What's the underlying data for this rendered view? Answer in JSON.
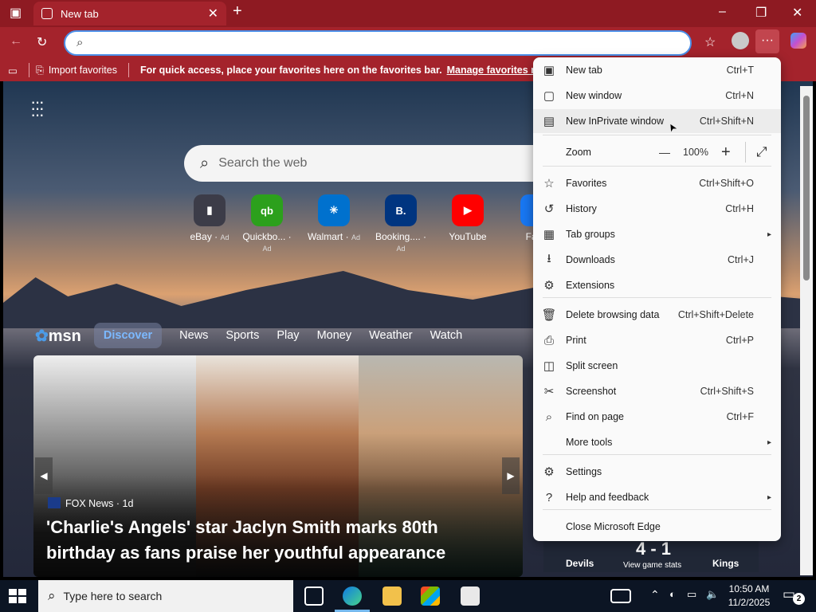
{
  "window": {
    "tab_title": "New tab",
    "tab_close_glyph": "✕",
    "new_tab_glyph": "+"
  },
  "favbar": {
    "import_label": "Import favorites",
    "prompt": "For quick access, place your favorites here on the favorites bar.",
    "manage_link": "Manage favorites now"
  },
  "newtab": {
    "search_placeholder": "Search the web",
    "tiles": [
      {
        "label": "eBay",
        "ad": "Ad",
        "icon": "ebay-icon",
        "color": "#3c3c48"
      },
      {
        "label": "Quickbo...",
        "ad": "Ad",
        "icon": "quickbooks-icon",
        "color": "#2ca01c"
      },
      {
        "label": "Walmart",
        "ad": "Ad",
        "icon": "walmart-icon",
        "color": "#0071ce"
      },
      {
        "label": "Booking....",
        "ad": "Ad",
        "icon": "booking-icon",
        "color": "#003580"
      },
      {
        "label": "YouTube",
        "ad": "",
        "icon": "youtube-icon",
        "color": "#ff0000"
      },
      {
        "label": "Face",
        "ad": "",
        "icon": "facebook-icon",
        "color": "#1877f2"
      }
    ],
    "tile_glyphs": [
      "▮",
      "qb",
      "✳",
      "B.",
      "▶",
      ""
    ]
  },
  "msn": {
    "logo": "msn",
    "tabs": [
      "Discover",
      "News",
      "Sports",
      "Play",
      "Money",
      "Weather",
      "Watch"
    ],
    "active_tab": "Discover",
    "story": {
      "source": "FOX News · 1d",
      "headline": "'Charlie's Angels' star Jaclyn Smith marks 80th birthday as fans praise her youthful appearance"
    },
    "score": {
      "team_left": "Devils",
      "team_right": "Kings",
      "score": "4 - 1",
      "link": "View game stats"
    }
  },
  "menu": {
    "items": [
      {
        "label": "New tab",
        "shortcut": "Ctrl+T",
        "icon": "new-tab-icon"
      },
      {
        "label": "New window",
        "shortcut": "Ctrl+N",
        "icon": "new-window-icon"
      },
      {
        "label": "New InPrivate window",
        "shortcut": "Ctrl+Shift+N",
        "icon": "inprivate-icon"
      },
      {
        "label": "Zoom",
        "value": "100%",
        "icon": ""
      },
      {
        "label": "Favorites",
        "shortcut": "Ctrl+Shift+O",
        "icon": "favorites-icon"
      },
      {
        "label": "History",
        "shortcut": "Ctrl+H",
        "icon": "history-icon"
      },
      {
        "label": "Tab groups",
        "shortcut": "",
        "icon": "tab-groups-icon"
      },
      {
        "label": "Downloads",
        "shortcut": "Ctrl+J",
        "icon": "downloads-icon"
      },
      {
        "label": "Extensions",
        "shortcut": "",
        "icon": "extensions-icon"
      },
      {
        "label": "Delete browsing data",
        "shortcut": "Ctrl+Shift+Delete",
        "icon": "trash-icon"
      },
      {
        "label": "Print",
        "shortcut": "Ctrl+P",
        "icon": "print-icon"
      },
      {
        "label": "Split screen",
        "shortcut": "",
        "icon": "split-screen-icon"
      },
      {
        "label": "Screenshot",
        "shortcut": "Ctrl+Shift+S",
        "icon": "screenshot-icon"
      },
      {
        "label": "Find on page",
        "shortcut": "Ctrl+F",
        "icon": "find-icon"
      },
      {
        "label": "More tools",
        "shortcut": "",
        "icon": ""
      },
      {
        "label": "Settings",
        "shortcut": "",
        "icon": "gear-icon"
      },
      {
        "label": "Help and feedback",
        "shortcut": "",
        "icon": "help-icon"
      },
      {
        "label": "Close Microsoft Edge",
        "shortcut": "",
        "icon": ""
      }
    ],
    "zoom_minus": "—",
    "zoom_plus": "+",
    "fullscreen_glyph": "⤢",
    "submenu_arrow": "▸",
    "icon_glyphs": [
      "▣",
      "▢",
      "▤",
      "",
      "☆",
      "↺",
      "▦",
      "⭳",
      "⚙",
      "🗑",
      "⎙",
      "◫",
      "✂",
      "⌕",
      "",
      "⚙",
      "?",
      ""
    ]
  },
  "taskbar": {
    "search_placeholder": "Type here to search",
    "time": "10:50 AM",
    "date": "11/2/2025",
    "notification_count": "2"
  },
  "colors": {
    "titlebar": "#8e1a22",
    "toolbar": "#a4232c",
    "accent_blue": "#4c8fe8",
    "taskbar": "#0c1524"
  }
}
